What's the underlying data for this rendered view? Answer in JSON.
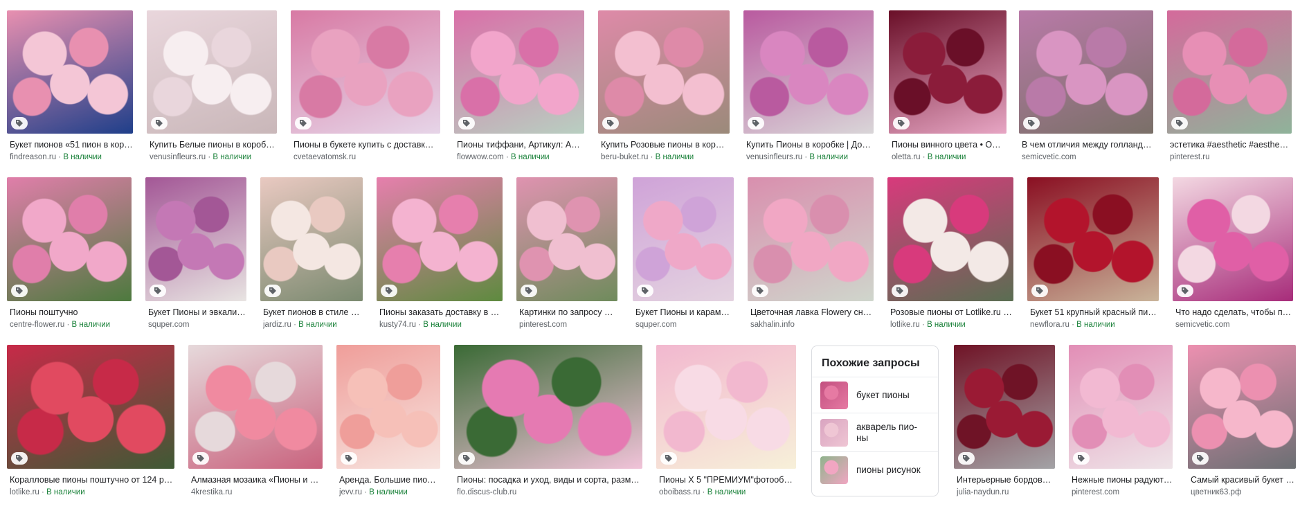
{
  "available_label": "В наличии",
  "row1": [
    {
      "title": "Букет пионов «51 пион в кор…",
      "source": "findreason.ru",
      "available": true,
      "colors": [
        "#f4c6d6",
        "#e890b0",
        "#1f3f8a"
      ]
    },
    {
      "title": "Купить Белые пионы в коробк…",
      "source": "venusinfleurs.ru",
      "available": true,
      "colors": [
        "#f7eef0",
        "#e9d6dc",
        "#c9b7b9"
      ]
    },
    {
      "title": "Пионы в букете купить с доставк…",
      "source": "cvetaevatomsk.ru",
      "available": false,
      "colors": [
        "#e9a2c0",
        "#d87aa4",
        "#e6d5e8"
      ]
    },
    {
      "title": "Пионы тиффани, Артикул: А1…",
      "source": "flowwow.com",
      "available": true,
      "colors": [
        "#f2a5cb",
        "#d970a8",
        "#b8cfc1"
      ]
    },
    {
      "title": "Купить Розовые пионы в кор…",
      "source": "beru-buket.ru",
      "available": true,
      "colors": [
        "#f3bfd0",
        "#de8aa8",
        "#9b8a7a"
      ]
    },
    {
      "title": "Купить Пионы в коробке | До…",
      "source": "venusinfleurs.ru",
      "available": true,
      "colors": [
        "#d986c0",
        "#b95a9f",
        "#d9d6d8"
      ]
    },
    {
      "title": "Пионы винного цвета • О…",
      "source": "oletta.ru",
      "available": true,
      "colors": [
        "#8b1c3a",
        "#6a0f28",
        "#e7a6c4"
      ]
    },
    {
      "title": "В чем отличия между голланд…",
      "source": "semicvetic.com",
      "available": false,
      "colors": [
        "#d995c2",
        "#b97aa8",
        "#7a7068"
      ]
    },
    {
      "title": "эстетика #aesthetic #aesthe…",
      "source": "pinterest.ru",
      "available": false,
      "colors": [
        "#e78fb5",
        "#d46a9b",
        "#8fb39a"
      ]
    }
  ],
  "row2": [
    {
      "title": "Пионы поштучно",
      "source": "centre-flower.ru",
      "available": true,
      "colors": [
        "#f1a8c9",
        "#e07eaa",
        "#4d7a3e"
      ]
    },
    {
      "title": "Букет Пионы и эвкали…",
      "source": "squper.com",
      "available": false,
      "colors": [
        "#c478b5",
        "#a35796",
        "#e8e4e2"
      ]
    },
    {
      "title": "Букет пионов в стиле …",
      "source": "jardiz.ru",
      "available": true,
      "colors": [
        "#f4e7e2",
        "#e9c9c1",
        "#7b8a70"
      ]
    },
    {
      "title": "Пионы заказать доставку в …",
      "source": "kusty74.ru",
      "available": true,
      "colors": [
        "#f4b3d0",
        "#e67fad",
        "#5e8a3f"
      ]
    },
    {
      "title": "Картинки по запросу …",
      "source": "pinterest.com",
      "available": false,
      "colors": [
        "#f0bfd0",
        "#df93b0",
        "#6f8b5c"
      ]
    },
    {
      "title": "Букет Пионы и карам…",
      "source": "squper.com",
      "available": false,
      "colors": [
        "#efa8c8",
        "#cfa3d8",
        "#e4d3e0"
      ]
    },
    {
      "title": "Цветочная лавка Flowery сн…",
      "source": "sakhalin.info",
      "available": false,
      "colors": [
        "#f1a7c4",
        "#d98fae",
        "#cfd6cc"
      ]
    },
    {
      "title": "Розовые пионы от Lotlike.ru …",
      "source": "lotlike.ru",
      "available": true,
      "colors": [
        "#f3e9e6",
        "#d83a7c",
        "#5a6e52"
      ]
    },
    {
      "title": "Букет 51 крупный красный пи…",
      "source": "newflora.ru",
      "available": true,
      "colors": [
        "#b3142c",
        "#8a0f22",
        "#c9b49a"
      ]
    },
    {
      "title": "Что надо сделать, чтобы пи…",
      "source": "semicvetic.com",
      "available": false,
      "colors": [
        "#e05fa6",
        "#f3d8e2",
        "#a72c7a"
      ]
    }
  ],
  "row3": [
    {
      "title": "Коралловые пионы поштучно от 124 р…",
      "source": "lotlike.ru",
      "available": true,
      "colors": [
        "#e14a60",
        "#c72a48",
        "#3f5a35"
      ]
    },
    {
      "title": "Алмазная мозаика «Пионы и …",
      "source": "4krestika.ru",
      "available": false,
      "colors": [
        "#f08aa0",
        "#e6d9db",
        "#c9637e"
      ]
    },
    {
      "title": "Аренда. Большие пио…",
      "source": "jevv.ru",
      "available": true,
      "colors": [
        "#f6c0b8",
        "#ef9e9a",
        "#f7e4df"
      ]
    },
    {
      "title": "Пионы: посадка и уход, виды и сорта, разм…",
      "source": "flo.discus-club.ru",
      "available": false,
      "colors": [
        "#e57ab2",
        "#3a6a35",
        "#f1c3d9"
      ]
    },
    {
      "title": "Пионы Х 5 \"ПРЕМИУМ\"фотообо…",
      "source": "oboibass.ru",
      "available": true,
      "colors": [
        "#f8dbe5",
        "#f2b8cf",
        "#f7f0d9"
      ]
    },
    {
      "title": "Интерьерные бордов…",
      "source": "julia-naydun.ru",
      "available": false,
      "colors": [
        "#9a1a34",
        "#6f1326",
        "#a3a3a6"
      ]
    },
    {
      "title": "Нежные пионы радуют…",
      "source": "pinterest.com",
      "available": false,
      "colors": [
        "#f2b9d2",
        "#e28eb6",
        "#eee4e8"
      ]
    },
    {
      "title": "Самый красивый букет …",
      "source": "цветник63.рф",
      "available": false,
      "colors": [
        "#f6b7cb",
        "#ec90b0",
        "#6b6f73"
      ]
    }
  ],
  "related": {
    "title": "Похожие запросы",
    "items": [
      {
        "label": "букет пионы",
        "colors": [
          "#e67aa3",
          "#c24f7f"
        ]
      },
      {
        "label": "акварель пио-ны",
        "colors": [
          "#efc6d4",
          "#d9a4c0"
        ]
      },
      {
        "label": "пионы рисунок",
        "colors": [
          "#f1a6c2",
          "#8fb38c"
        ]
      }
    ]
  }
}
